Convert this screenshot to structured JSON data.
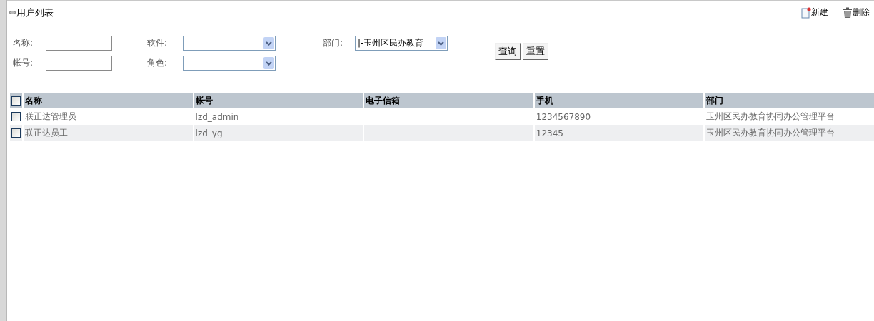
{
  "panel": {
    "title": "用户列表",
    "actions": [
      {
        "kind": "new",
        "label": "新建"
      },
      {
        "kind": "delete",
        "label": "删除"
      }
    ]
  },
  "filters": [
    {
      "kind": "text",
      "label": "名称:"
    },
    {
      "kind": "select",
      "label": "软件:"
    },
    {
      "kind": "select",
      "label": "部门:",
      "value": "|-玉州区民办教育"
    },
    {
      "kind": "text",
      "label": "帐号:"
    },
    {
      "kind": "select",
      "label": "角色:"
    }
  ],
  "buttons": [
    "查询",
    "重置"
  ],
  "table": {
    "select_all_checked": false,
    "columns": [
      "名称",
      "帐号",
      "电子信箱",
      "手机",
      "部门"
    ],
    "rows": [
      {
        "checked": false,
        "cells": [
          "联正达管理员",
          "lzd_admin",
          "",
          "1234567890",
          "玉州区民办教育协同办公管理平台"
        ]
      },
      {
        "checked": false,
        "cells": [
          "联正达员工",
          "lzd_yg",
          "",
          "12345",
          "玉州区民办教育协同办公管理平台"
        ]
      }
    ]
  }
}
